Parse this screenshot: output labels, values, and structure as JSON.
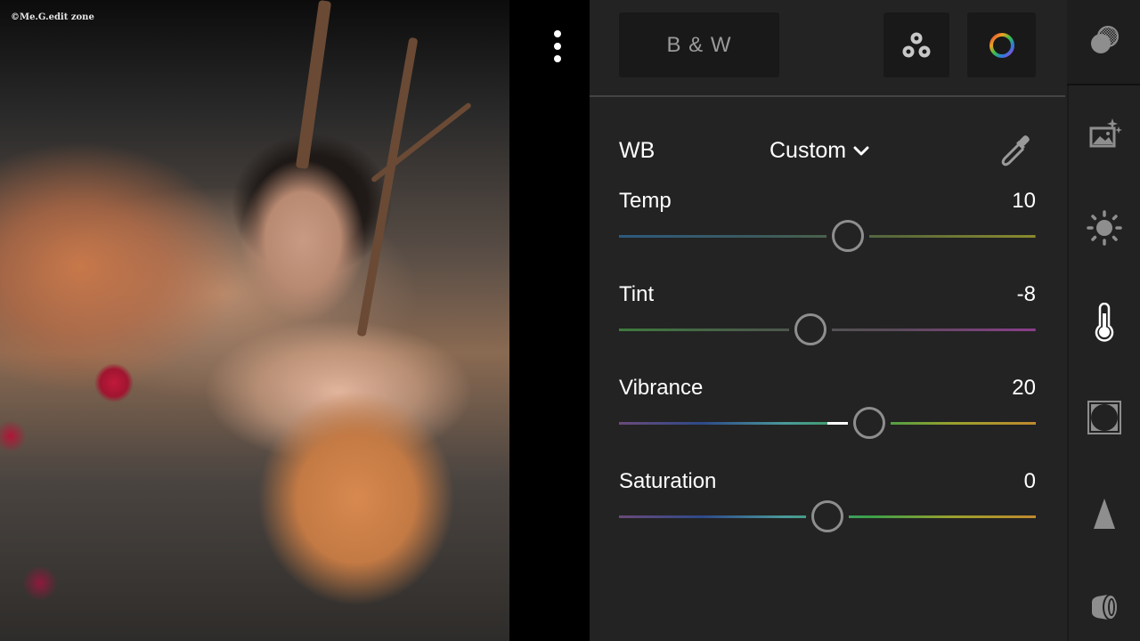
{
  "photo": {
    "watermark": "©Me.G.edit zone",
    "description": "Portrait of a woman among roses with orange-toned background"
  },
  "toolbar": {
    "more_icon": "more-vertical-icon",
    "bw_label": "B & W",
    "mixer_icon": "color-mixer-icon",
    "color_grading_icon": "color-wheel-icon"
  },
  "white_balance": {
    "label": "WB",
    "mode": "Custom",
    "mode_icon": "chevron-down-icon",
    "picker_icon": "eyedropper-icon"
  },
  "sliders": [
    {
      "name": "temp",
      "label": "Temp",
      "value": "10",
      "numeric": 10,
      "min": -100,
      "max": 100,
      "gradient": [
        "#2d5a7e",
        "#3a5a5e",
        "#5a6a3a",
        "#8a8a2e"
      ]
    },
    {
      "name": "tint",
      "label": "Tint",
      "value": "-8",
      "numeric": -8,
      "min": -100,
      "max": 100,
      "gradient": [
        "#3e7a3e",
        "#4a5a4a",
        "#5a4a5a",
        "#8a3e8a"
      ]
    },
    {
      "name": "vibrance",
      "label": "Vibrance",
      "value": "20",
      "numeric": 20,
      "min": -100,
      "max": 100,
      "gradient": [
        "#6a4a7a",
        "#2e4a8a",
        "#4a9a9a",
        "#3aa04a",
        "#9aa02e",
        "#c08a2e"
      ]
    },
    {
      "name": "saturation",
      "label": "Saturation",
      "value": "0",
      "numeric": 0,
      "min": -100,
      "max": 100,
      "gradient": [
        "#6a4a7a",
        "#2e4a8a",
        "#4a9a9a",
        "#3aa04a",
        "#9aa02e",
        "#c08a2e"
      ]
    }
  ],
  "sidebar": {
    "items": [
      {
        "name": "masking",
        "icon": "masking-icon",
        "active": false
      },
      {
        "name": "auto",
        "icon": "auto-enhance-icon",
        "active": false
      },
      {
        "name": "light",
        "icon": "light-sun-icon",
        "active": false
      },
      {
        "name": "color",
        "icon": "thermometer-icon",
        "active": true
      },
      {
        "name": "effects",
        "icon": "vignette-effects-icon",
        "active": false
      },
      {
        "name": "detail",
        "icon": "detail-triangle-icon",
        "active": false
      },
      {
        "name": "optics",
        "icon": "lens-optics-icon",
        "active": false
      }
    ]
  },
  "colors": {
    "panel_bg": "#232323",
    "button_bg": "#191919",
    "accent_text": "#ffffff",
    "muted_text": "#9a9a9a",
    "icon_gray": "#8e8e8e"
  }
}
